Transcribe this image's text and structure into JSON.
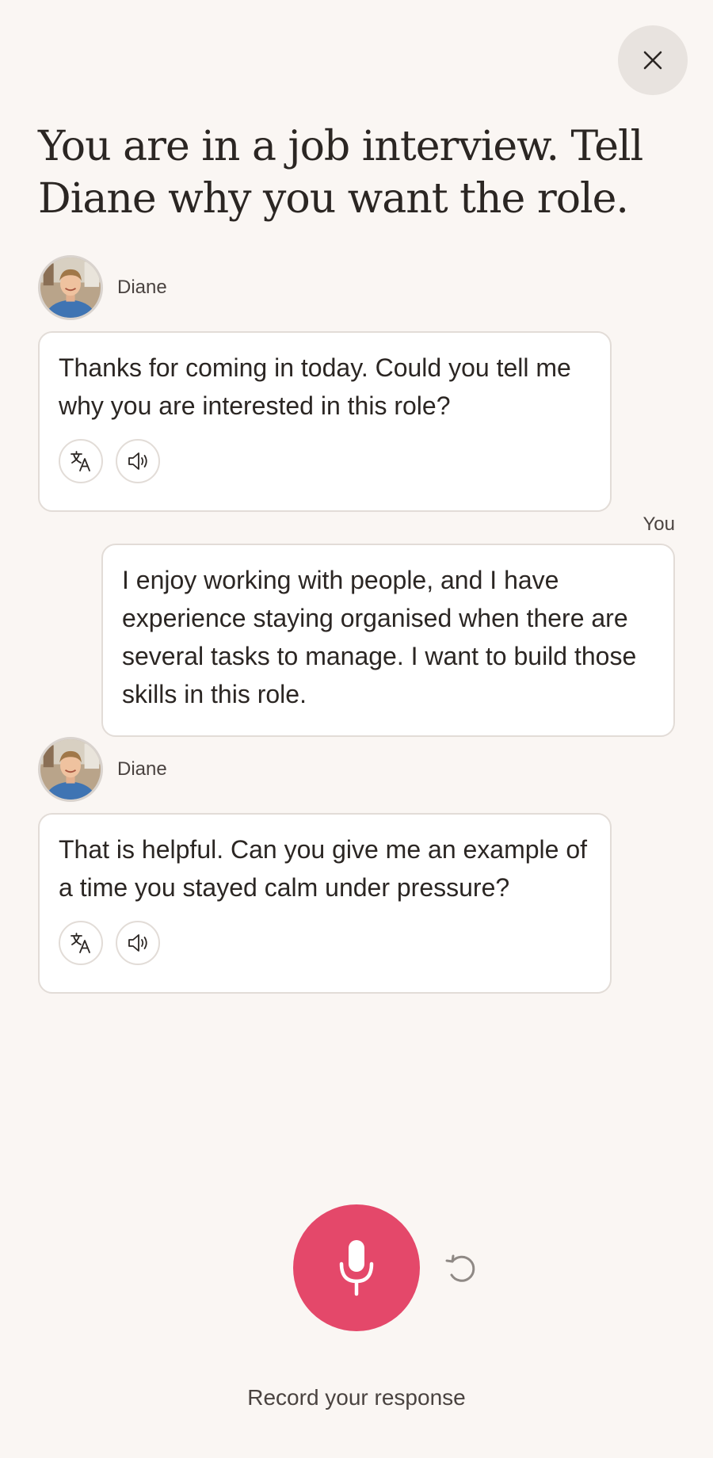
{
  "header": {
    "close_icon": "close-icon"
  },
  "prompt": {
    "title": "You are in a job interview. Tell Diane why you want the role."
  },
  "conversation": {
    "messages": [
      {
        "speaker": "Diane",
        "role": "partner",
        "text": "Thanks for coming in today. Could you tell me why you are interested in this role?",
        "actions": [
          "translate-icon",
          "speaker-icon"
        ]
      },
      {
        "speaker": "You",
        "role": "user",
        "text": "I enjoy working with people, and I have experience staying organised when there are several tasks to manage. I want to build those skills in this role."
      },
      {
        "speaker": "Diane",
        "role": "partner",
        "text": "That is helpful. Can you give me an example of a time you stayed calm under pressure?",
        "actions": [
          "translate-icon",
          "speaker-icon"
        ]
      }
    ]
  },
  "footer": {
    "mic_icon": "microphone-icon",
    "retry_icon": "retry-icon",
    "record_label": "Record your response"
  },
  "colors": {
    "background": "#faf6f3",
    "accent": "#e4486a",
    "bubble_border": "#e2dcd7",
    "close_button_bg": "#e8e3df"
  }
}
